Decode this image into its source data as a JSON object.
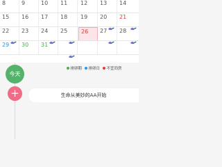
{
  "calendar": {
    "weeks": [
      {
        "days": [
          {
            "label": "8",
            "color": "gray",
            "bird": false
          },
          {
            "label": "9",
            "color": "gray",
            "bird": false
          },
          {
            "label": "10",
            "color": "gray",
            "bird": false
          },
          {
            "label": "11",
            "color": "gray",
            "bird": false
          },
          {
            "label": "12",
            "color": "gray",
            "bird": false
          },
          {
            "label": "13",
            "color": "gray",
            "bird": false
          },
          {
            "label": "14",
            "color": "gray",
            "bird": false
          }
        ]
      },
      {
        "days": [
          {
            "label": "15",
            "color": "gray",
            "bird": false
          },
          {
            "label": "16",
            "color": "gray",
            "bird": false
          },
          {
            "label": "17",
            "color": "gray",
            "bird": false
          },
          {
            "label": "18",
            "color": "gray",
            "bird": false
          },
          {
            "label": "19",
            "color": "gray",
            "bird": false
          },
          {
            "label": "20",
            "color": "gray",
            "bird": true
          },
          {
            "label": "21",
            "color": "red",
            "bird": true
          }
        ]
      },
      {
        "days": [
          {
            "label": "22",
            "color": "gray",
            "bird": true
          },
          {
            "label": "23",
            "color": "gray",
            "bird": false
          },
          {
            "label": "24",
            "color": "gray",
            "bird": true
          },
          {
            "label": "25",
            "color": "gray",
            "bird": true
          },
          {
            "label": "26",
            "color": "red",
            "bird": false,
            "today": true
          },
          {
            "label": "27",
            "color": "gray",
            "bird": true
          },
          {
            "label": "28",
            "color": "gray",
            "bird": true
          }
        ]
      },
      {
        "days": [
          {
            "label": "29",
            "color": "blue",
            "bird": false
          },
          {
            "label": "30",
            "color": "green",
            "bird": false
          },
          {
            "label": "31",
            "color": "green",
            "bird": false
          },
          {
            "label": "",
            "color": "gray",
            "bird": true
          },
          {
            "label": "",
            "color": "gray",
            "bird": false
          },
          {
            "label": "",
            "color": "gray",
            "bird": false
          },
          {
            "label": "",
            "color": "gray",
            "bird": false
          }
        ]
      }
    ]
  },
  "legend": {
    "items": [
      {
        "label": "排卵期",
        "color": "#4caf50"
      },
      {
        "label": "排卵日",
        "color": "#2196f3"
      },
      {
        "label": "不宜同房",
        "color": "#e53935"
      }
    ]
  },
  "timeline": {
    "today_label": "今天",
    "add_label": "+",
    "message": "生命从美妙的AA开始"
  },
  "colors": {
    "accent_green": "#55b26a",
    "accent_pink": "#ef6b86",
    "today_bg": "#fde4e8"
  },
  "icons": {
    "bird": "bird-icon"
  }
}
